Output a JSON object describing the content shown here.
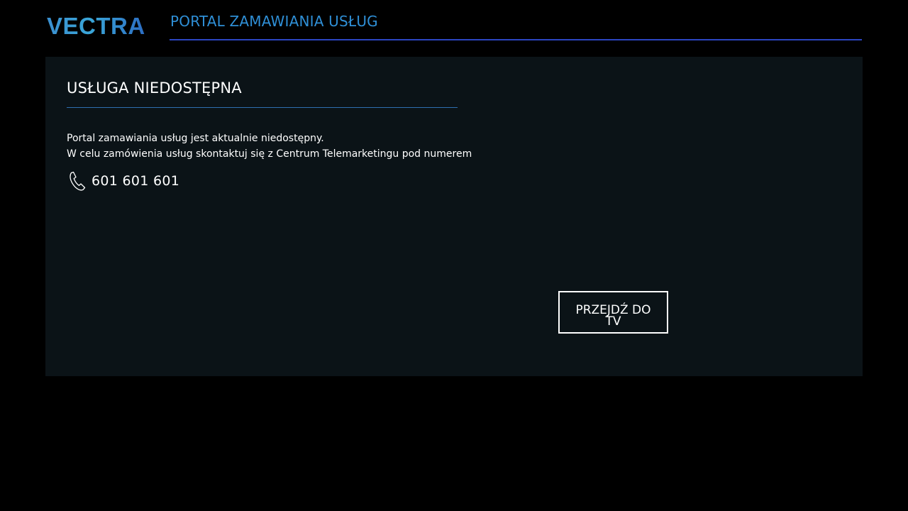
{
  "header": {
    "logo_text": "VECTRA",
    "title": "PORTAL ZAMAWIANIA USŁUG"
  },
  "panel": {
    "title": "USŁUGA NIEDOSTĘPNA",
    "message_line_1": "Portal zamawiania usług jest aktualnie niedostępny.",
    "message_line_2": "W celu zamówienia usług skontaktuj się z Centrum Telemarketingu pod numerem",
    "phone_icon": "phone-icon",
    "phone_number": "601 601 601",
    "button_label": "PRZEJDŹ DO TV"
  },
  "colors": {
    "background": "#000000",
    "panel": "#0b1317",
    "accent_blue": "#2f8fd6",
    "header_rule": "#2b46c2",
    "text": "#ffffff"
  }
}
